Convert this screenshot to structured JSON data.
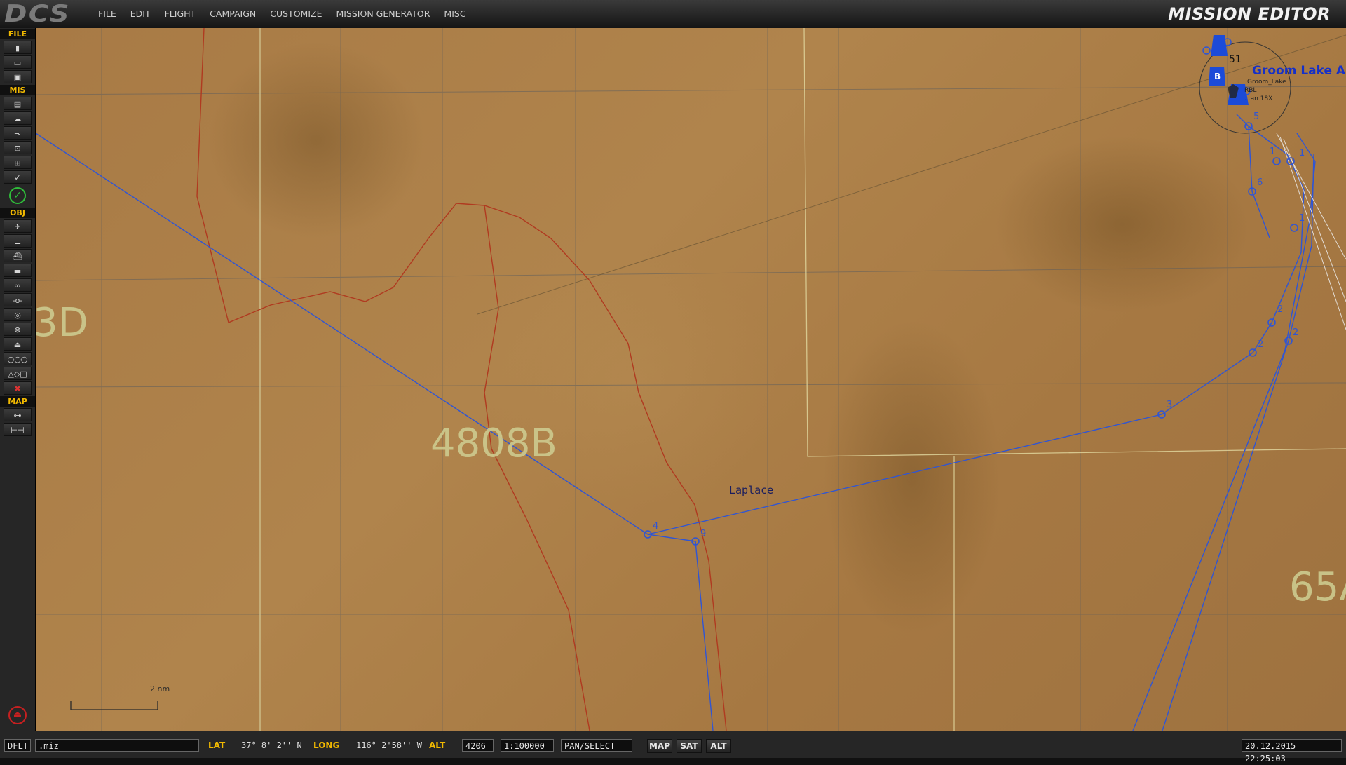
{
  "app": {
    "logo": "DCS",
    "title": "MISSION EDITOR"
  },
  "menu": [
    "FILE",
    "EDIT",
    "FLIGHT",
    "CAMPAIGN",
    "CUSTOMIZE",
    "MISSION GENERATOR",
    "MISC"
  ],
  "sidebar": {
    "sections": {
      "file": "FILE",
      "mis": "MIS",
      "obj": "OBJ",
      "map": "MAP"
    },
    "file_tools": [
      "new-file-icon",
      "open-file-icon",
      "save-file-icon"
    ],
    "mis_tools": [
      "briefing-icon",
      "weather-icon",
      "goals-icon",
      "triggers-icon",
      "resource-icon",
      "check-icon"
    ],
    "obj_tools": [
      "plane-icon",
      "helicopter-icon",
      "ship-icon",
      "vehicle-icon",
      "group-icon",
      "static-icon",
      "zone-icon",
      "template-icon",
      "warehouse-icon",
      "formation-icon",
      "shapes-icon",
      "delete-icon"
    ],
    "map_tools": [
      "key-icon",
      "ruler-icon"
    ]
  },
  "map": {
    "zone_labels": {
      "left": "3D",
      "center": "4808B",
      "right": "65A"
    },
    "place_label": "Laplace",
    "airbase": {
      "name": "Groom Lake A",
      "area_label": "51",
      "sub_lines": [
        "Groom_Lake",
        "RBL",
        "...an 18X"
      ]
    },
    "waypoint_labels": [
      "4",
      "9",
      "3",
      "2",
      "2",
      "2",
      "1",
      "1",
      "6",
      "5",
      "1"
    ],
    "scale_label": "2 nm"
  },
  "statusbar": {
    "profile": "DFLT",
    "file_name": ".miz",
    "lat_label": "LAT",
    "lat_value": "37° 8' 2'' N",
    "long_label": "LONG",
    "long_value": "116° 2'58'' W",
    "alt_label": "ALT",
    "alt_value": "4206",
    "scale_value": "1:100000",
    "mode_value": "PAN/SELECT",
    "map_btn": "MAP",
    "sat_btn": "SAT",
    "alt_btn": "ALT",
    "datetime": "20.12.2015 22:25:03"
  },
  "colors": {
    "accent": "#f0b800",
    "route": "#2f55d4",
    "border": "#b03a20",
    "zone_text": "#cdcb8f"
  }
}
